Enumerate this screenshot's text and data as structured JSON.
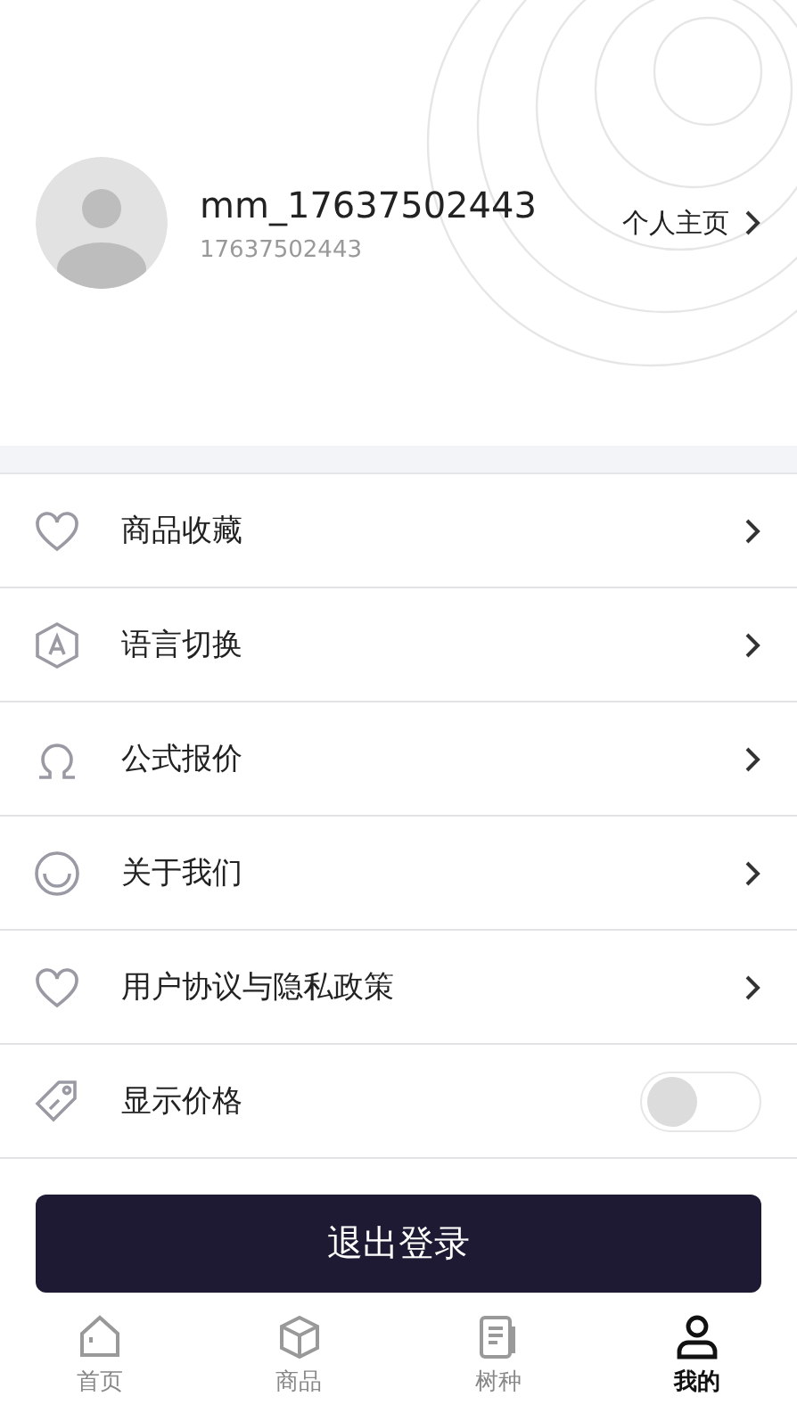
{
  "profile": {
    "username": "mm_17637502443",
    "account": "17637502443",
    "homepage_link": "个人主页"
  },
  "menu": [
    {
      "kind": "link",
      "label": "商品收藏"
    },
    {
      "kind": "link",
      "label": "语言切换"
    },
    {
      "kind": "link",
      "label": "公式报价"
    },
    {
      "kind": "link",
      "label": "关于我们"
    },
    {
      "kind": "link",
      "label": "用户协议与隐私政策"
    },
    {
      "kind": "toggle",
      "label": "显示价格",
      "on": false
    }
  ],
  "logout_button": "退出登录",
  "tab_bar": [
    {
      "label": "首页",
      "selected": false
    },
    {
      "label": "商品",
      "selected": false
    },
    {
      "label": "树种",
      "selected": false
    },
    {
      "label": "我的",
      "selected": true
    }
  ]
}
